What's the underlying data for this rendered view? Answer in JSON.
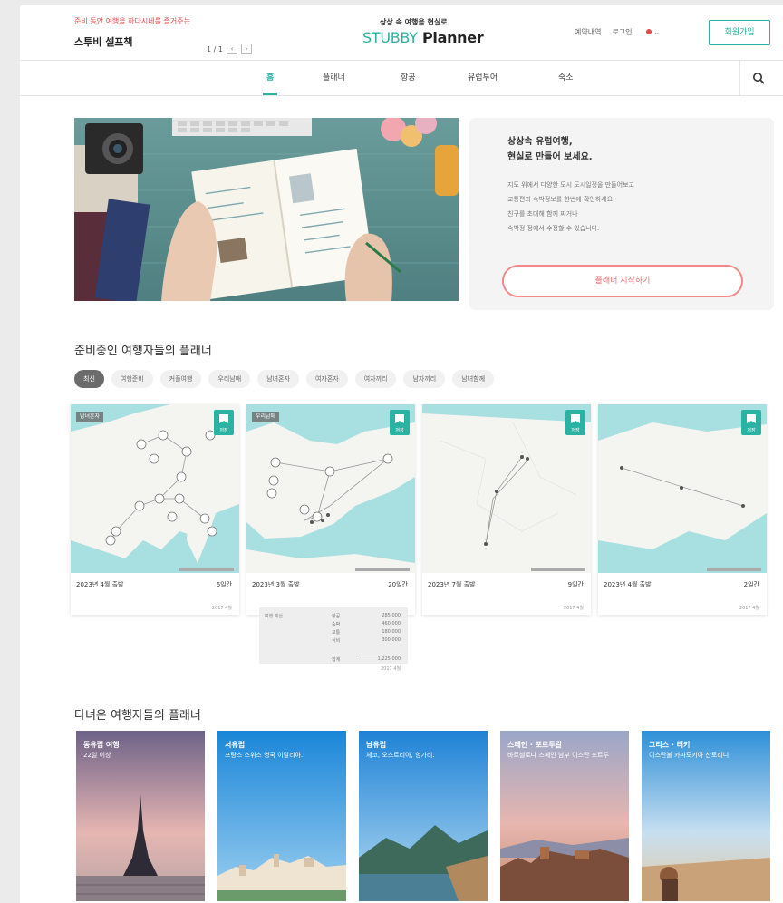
{
  "header": {
    "promo": "준비 동안 여행을 하다시네를 즐거주는",
    "store": "스투비 셀프책",
    "pager": "1 / 1",
    "pager_prev": "‹",
    "pager_next": "›",
    "logo_tag": "상상 속 여행을 현실로",
    "logo_a": "STUBBY",
    "logo_b": " Planner",
    "links": [
      "예약내역",
      "로그인"
    ],
    "lang_chevron": "⌄",
    "signup": "회원가입"
  },
  "nav": {
    "items": [
      "홈",
      "플래너",
      "항공",
      "유럽투어",
      "숙소"
    ]
  },
  "hero": {
    "title_lines": [
      "상상속 유럽여행,",
      "현실로 만들어 보세요."
    ],
    "desc_lines": [
      "지도 위에서 다양한 도시 도시일정을 만들어보고",
      "교통편과 숙박정보를 한번에 확인하세요.",
      "친구를 초대해 함께 짜거나",
      "숙박정 정에서 수정할 수 있습니다."
    ],
    "cta": "플래너 시작하기"
  },
  "section_ongoing": {
    "title": "준비중인 여행자들의 플래너",
    "filters": [
      "최신",
      "여행준비",
      "커플여행",
      "우리남매",
      "남녀혼자",
      "여자혼자",
      "여자끼리",
      "남자끼리",
      "남녀함께"
    ],
    "bookmark_label": "저장",
    "cards": [
      {
        "tag": "남녀혼자",
        "date": "2023년 4월 출발",
        "duration": "6일간",
        "sub": "2017 4월"
      },
      {
        "tag": "우리남매",
        "date": "2023년 3월 출발",
        "duration": "20일간",
        "sub": "2017 4월"
      },
      {
        "tag": "",
        "date": "2023년 7월 출발",
        "duration": "9일간",
        "sub": "2017 4월"
      },
      {
        "tag": "",
        "date": "2023년 4월 출발",
        "duration": "2일간",
        "sub": "2017 4월"
      }
    ],
    "budget": {
      "title": "여행 예산",
      "rows": [
        [
          "항공",
          "285,000"
        ],
        [
          "숙박",
          "460,000"
        ],
        [
          "교통",
          "180,000"
        ],
        [
          "식비",
          "300,000"
        ],
        [
          "합계",
          "1,225,000"
        ]
      ],
      "sub": "2017 4월"
    }
  },
  "section_done": {
    "title": "다녀온 여행자들의 플래너",
    "photos": [
      {
        "title": "동유럽 여행",
        "desc": "22일 이상"
      },
      {
        "title": "서유럽",
        "desc": "프랑스 스위스 영국 이탈리아."
      },
      {
        "title": "남유럽",
        "desc": "체코, 오스트리아, 헝가리."
      },
      {
        "title": "스페인 · 포르투갈",
        "desc": "바르셀로나 스페인 남부 이스탄 포르투"
      },
      {
        "title": "그리스 · 터키",
        "desc": "이스탄불 카파도키아 산토리니"
      }
    ]
  },
  "colors": {
    "accent": "#2ab3a3",
    "cta": "#e86b6b",
    "map_water": "#a8dfe0",
    "map_land": "#f4f4f1"
  }
}
